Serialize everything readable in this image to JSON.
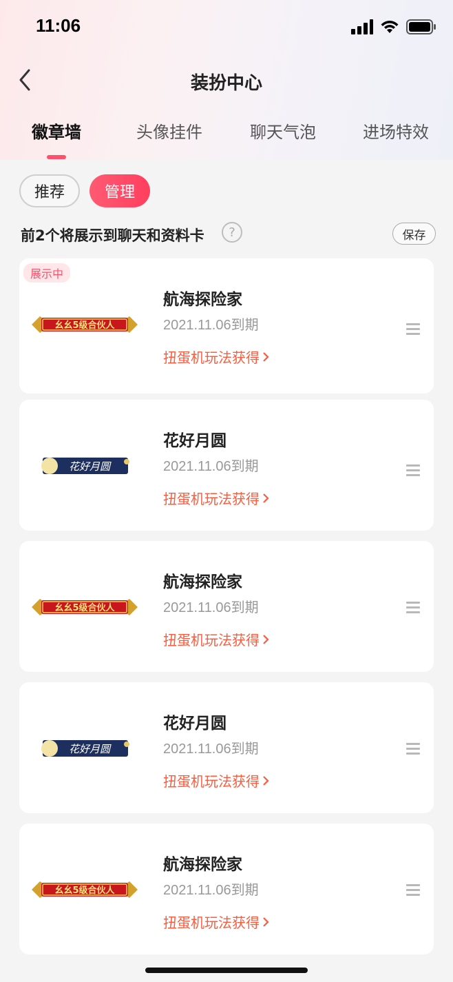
{
  "status": {
    "time": "11:06"
  },
  "header": {
    "title": "装扮中心"
  },
  "tabs": [
    {
      "label": "徽章墙"
    },
    {
      "label": "头像挂件"
    },
    {
      "label": "聊天气泡"
    },
    {
      "label": "进场特效"
    }
  ],
  "filters": {
    "recommend": "推荐",
    "manage": "管理"
  },
  "hint": {
    "text": "前2个将展示到聊天和资料卡",
    "help": "?",
    "save": "保存"
  },
  "cards": [
    {
      "tag": "展示中",
      "name": "航海探险家",
      "expiry": "2021.11.06到期",
      "link": "扭蛋机玩法获得",
      "badge_text": "幺幺5级合伙人",
      "badge_style": "red"
    },
    {
      "name": "花好月圆",
      "expiry": "2021.11.06到期",
      "link": "扭蛋机玩法获得",
      "badge_text": "花好月圆",
      "badge_style": "navy"
    },
    {
      "name": "航海探险家",
      "expiry": "2021.11.06到期",
      "link": "扭蛋机玩法获得",
      "badge_text": "幺幺5级合伙人",
      "badge_style": "red"
    },
    {
      "name": "花好月圆",
      "expiry": "2021.11.06到期",
      "link": "扭蛋机玩法获得",
      "badge_text": "花好月圆",
      "badge_style": "navy"
    },
    {
      "name": "航海探险家",
      "expiry": "2021.11.06到期",
      "link": "扭蛋机玩法获得",
      "badge_text": "幺幺5级合伙人",
      "badge_style": "red"
    }
  ],
  "colors": {
    "accent": "#ff4f6b",
    "link": "#ff5a3c"
  }
}
